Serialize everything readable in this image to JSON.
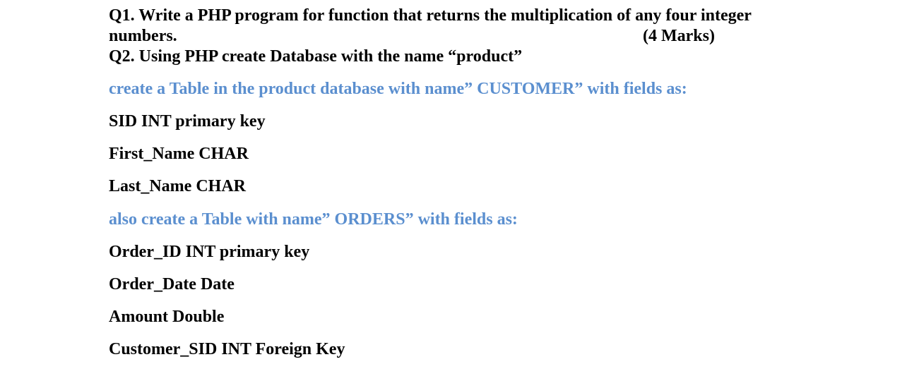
{
  "document": {
    "q1": {
      "line1": "Q1. Write a PHP program for function that returns the multiplication of any four integer",
      "line2": "numbers.",
      "marks": "(4 Marks)"
    },
    "q2": {
      "heading": "Q2.  Using PHP create Database with the name “product”",
      "customer_intro": "create a Table in the product database with name” CUSTOMER” with fields as:",
      "customer_fields": [
        "SID INT primary key",
        "First_Name CHAR",
        "Last_Name CHAR"
      ],
      "orders_intro": "also create a Table with name” ORDERS” with fields as:",
      "orders_fields": [
        "Order_ID INT primary key",
        "Order_Date Date",
        "Amount Double",
        "Customer_SID INT Foreign Key"
      ]
    },
    "colors": {
      "text": "#000000",
      "accent_blue": "#5b8fcf"
    }
  }
}
